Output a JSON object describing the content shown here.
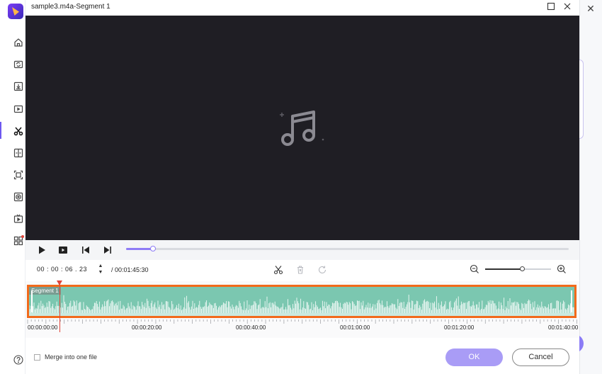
{
  "window": {
    "title": "sample3.m4a-Segment 1",
    "maximize_icon": "maximize-icon",
    "close_icon": "close-icon"
  },
  "sidebar": {
    "items": [
      {
        "name": "home-icon"
      },
      {
        "name": "convert-icon"
      },
      {
        "name": "download-icon"
      },
      {
        "name": "video-icon"
      },
      {
        "name": "trim-scissors-icon",
        "active": true
      },
      {
        "name": "merge-icon"
      },
      {
        "name": "screen-record-icon"
      },
      {
        "name": "dvd-icon"
      },
      {
        "name": "player-icon"
      },
      {
        "name": "toolbox-icon",
        "badge": true
      }
    ],
    "help_icon": "help-icon"
  },
  "player": {
    "progress": 0.06,
    "current_time": "00 : 00 : 06 . 23",
    "total_time": "/ 00:01:45:30",
    "zoom_level": 0.56
  },
  "timeline": {
    "segment_label": "Segment 1",
    "ruler_labels": [
      "00:00:00:00",
      "00:00:20:00",
      "00:00:40:00",
      "00:01:00:00",
      "00:01:20:00",
      "00:01:40:00"
    ]
  },
  "footer": {
    "merge_label": "Merge into one file",
    "ok_label": "OK",
    "cancel_label": "Cancel"
  },
  "colors": {
    "accent": "#8e7cf6",
    "segment_border": "#f26a1b",
    "waveform": "#7bc7b0",
    "playhead": "#e0453a",
    "preview_bg": "#1f1e24"
  }
}
